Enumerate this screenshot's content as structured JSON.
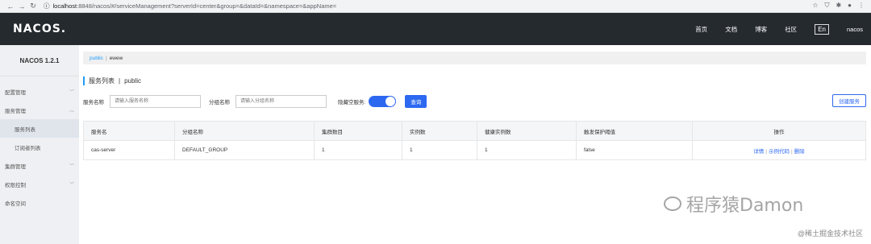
{
  "browser": {
    "url_host": "localhost",
    "url_path": ":8848/nacos/#/serviceManagement?serverId=center&group=&dataId=&namespace=&appName="
  },
  "header": {
    "logo": "NACOS.",
    "menu": [
      "首页",
      "文档",
      "博客",
      "社区",
      "En",
      "nacos"
    ]
  },
  "sidebar": {
    "title": "NACOS 1.2.1",
    "items": [
      {
        "label": "配置管理"
      },
      {
        "label": "服务管理"
      },
      {
        "label": "服务列表"
      },
      {
        "label": "订阅者列表"
      },
      {
        "label": "集群管理"
      },
      {
        "label": "权限控制"
      },
      {
        "label": "命名空间"
      }
    ]
  },
  "namespace_bar": {
    "active": "public",
    "other": "ewew"
  },
  "page": {
    "title": "服务列表",
    "namespace": "public"
  },
  "search": {
    "service_label": "服务名称",
    "service_placeholder": "请输入服务名称",
    "group_label": "分组名称",
    "group_placeholder": "请输入分组名称",
    "hide_empty_label": "隐藏空服务:",
    "query_button": "查询",
    "create_button": "创建服务"
  },
  "table": {
    "headers": [
      "服务名",
      "分组名称",
      "集群数目",
      "实例数",
      "健康实例数",
      "触发保护阈值",
      "操作"
    ],
    "rows": [
      {
        "name": "cas-server",
        "group": "DEFAULT_GROUP",
        "clusters": "1",
        "instances": "1",
        "healthy": "1",
        "protect": "false"
      }
    ],
    "actions": {
      "detail": "详情",
      "sample": "示例代码",
      "delete": "删除"
    }
  },
  "watermark": {
    "text": "程序猿Damon",
    "credit": "@稀土掘金技术社区"
  }
}
